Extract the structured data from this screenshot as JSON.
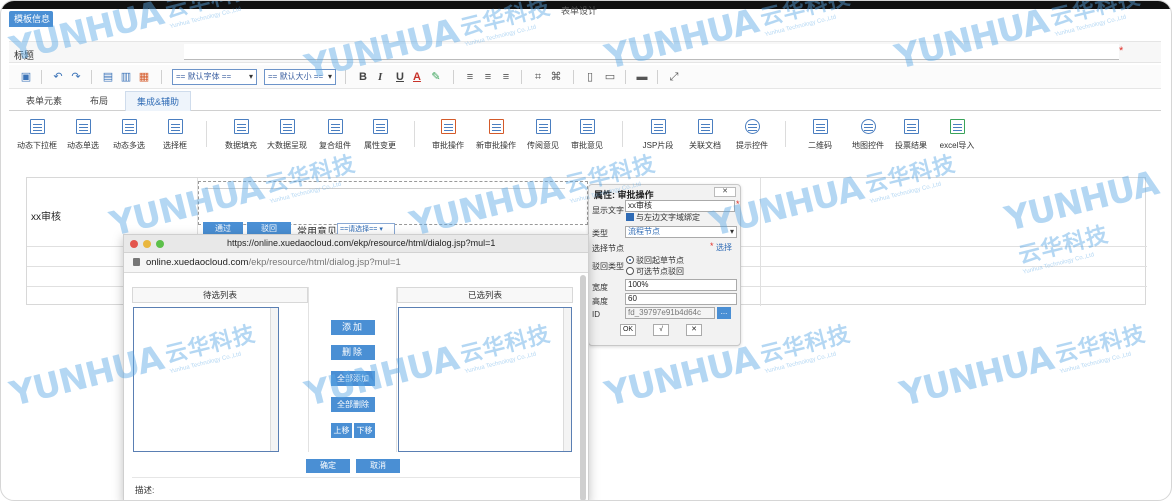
{
  "window": {
    "editor_tab": "模板信息",
    "editor_title": "表单设计"
  },
  "form_header": {
    "title_label": "标题",
    "required_mark": "*"
  },
  "toolbar": {
    "font_family_select": "== 默认字体 ==",
    "font_size_select": "== 默认大小 ==",
    "bold": "B",
    "italic": "I",
    "underline": "U",
    "font_color": "A",
    "caret": "▾"
  },
  "tabs": [
    "表单元素",
    "布局",
    "集成&辅助"
  ],
  "ribbon": [
    {
      "label": "动态下拉框",
      "icon": "dropdown-icon"
    },
    {
      "label": "动态单选",
      "icon": "radio-list-icon"
    },
    {
      "label": "动态多选",
      "icon": "checkbox-list-icon"
    },
    {
      "label": "选择框",
      "icon": "select-box-icon"
    },
    {
      "label": "数据填充",
      "icon": "data-fill-icon"
    },
    {
      "label": "大数据呈现",
      "icon": "big-data-icon"
    },
    {
      "label": "复合组件",
      "icon": "composite-icon"
    },
    {
      "label": "属性变更",
      "icon": "property-change-icon"
    },
    {
      "label": "审批操作",
      "icon": "approval-icon"
    },
    {
      "label": "新审批操作",
      "icon": "new-approval-icon"
    },
    {
      "label": "传阅意见",
      "icon": "circulate-icon"
    },
    {
      "label": "审批意见",
      "icon": "opinion-icon"
    },
    {
      "label": "JSP片段",
      "icon": "jsp-icon"
    },
    {
      "label": "关联文档",
      "icon": "linked-doc-icon"
    },
    {
      "label": "提示控件",
      "icon": "help-icon"
    },
    {
      "label": "二维码",
      "icon": "qrcode-icon"
    },
    {
      "label": "地图控件",
      "icon": "map-icon"
    },
    {
      "label": "投票结果",
      "icon": "vote-chart-icon"
    },
    {
      "label": "excel导入",
      "icon": "excel-import-icon"
    }
  ],
  "canvas": {
    "row_label": "xx审核",
    "approve_button": "通过",
    "reject_button": "驳回",
    "common_opinion_label": "常用意见",
    "opinion_select": "==请选择==",
    "caret": "▾"
  },
  "properties_panel": {
    "title": "属性: 审批操作",
    "close": "✕",
    "display_text_label": "显示文字",
    "display_text_value": "xx审核",
    "bind_left_text": "与左边文字域绑定",
    "type_label": "类型",
    "type_value": "流程节点",
    "select_node_label": "选择节点",
    "select_node_link": "选择",
    "reject_type_label": "驳回类型",
    "reject_option_1": "驳回起草节点",
    "reject_option_2": "可选节点驳回",
    "width_label": "宽度",
    "width_value": "100%",
    "height_label": "高度",
    "height_value": "60",
    "id_label": "ID",
    "id_value": "fd_39797e91b4d64c",
    "id_button": "...",
    "ok_button": "OK",
    "check_button": "√",
    "cancel_button": "✕",
    "required_mark": "*"
  },
  "dialog": {
    "window_title": "https://online.xuedaocloud.com/ekp/resource/html/dialog.jsp?mul=1",
    "url_host": "online.xuedaocloud.com",
    "url_path": "/ekp/resource/html/dialog.jsp?mul=1",
    "pending_list_title": "待选列表",
    "selected_list_title": "已选列表",
    "add_button": "添加",
    "remove_button": "删除",
    "add_all_button": "全部添加",
    "remove_all_button": "全部删除",
    "move_up_button": "上移",
    "move_down_button": "下移",
    "confirm_button": "确定",
    "cancel_button": "取消",
    "description_label": "描述:"
  },
  "watermark": {
    "logo": "YUNHUA",
    "brand_cn": "云华科技",
    "brand_en": "Yunhua Technology Co.,Ltd"
  },
  "colors": {
    "accent": "#4a8fd4",
    "required": "#e0302a",
    "watermark": "#5aa8e6",
    "mac_close": "#e3564d",
    "mac_min": "#e9b73e",
    "mac_max": "#5cc04a"
  }
}
